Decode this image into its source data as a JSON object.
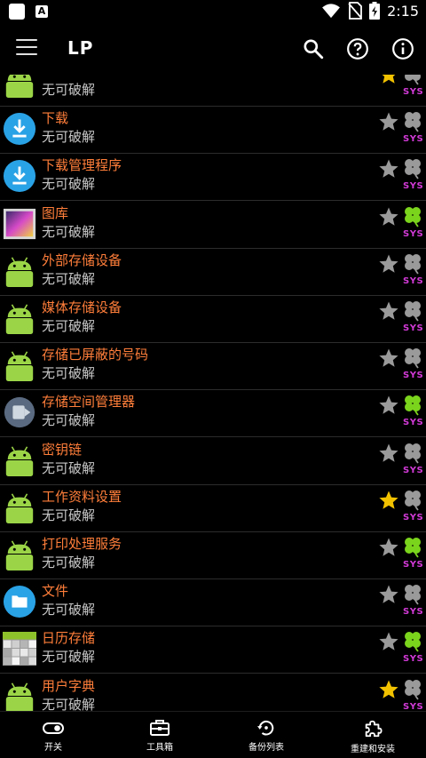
{
  "status_bar": {
    "time": "2:15",
    "icons": [
      "notification-square-icon",
      "text-a-icon",
      "wifi-icon",
      "no-sim-icon",
      "battery-charging-icon"
    ]
  },
  "app_bar": {
    "title": "LP",
    "icons": [
      "menu-icon",
      "search-icon",
      "help-icon",
      "info-icon"
    ]
  },
  "apps": [
    {
      "name": "",
      "status": "无可破解",
      "icon": "android-icon",
      "star": "gold",
      "clover": "gray",
      "badge": "SYS"
    },
    {
      "name": "下载",
      "status": "无可破解",
      "icon": "download-icon",
      "star": "gray",
      "clover": "gray",
      "badge": "SYS"
    },
    {
      "name": "下载管理程序",
      "status": "无可破解",
      "icon": "download-icon",
      "star": "gray",
      "clover": "gray",
      "badge": "SYS"
    },
    {
      "name": "图库",
      "status": "无可破解",
      "icon": "gallery-icon",
      "star": "gray",
      "clover": "green",
      "badge": "SYS"
    },
    {
      "name": "外部存储设备",
      "status": "无可破解",
      "icon": "android-icon",
      "star": "gray",
      "clover": "gray",
      "badge": "SYS"
    },
    {
      "name": "媒体存储设备",
      "status": "无可破解",
      "icon": "android-icon",
      "star": "gray",
      "clover": "gray",
      "badge": "SYS"
    },
    {
      "name": "存储已屏蔽的号码",
      "status": "无可破解",
      "icon": "android-icon",
      "star": "gray",
      "clover": "gray",
      "badge": "SYS"
    },
    {
      "name": "存储空间管理器",
      "status": "无可破解",
      "icon": "storage-manager-icon",
      "star": "gray",
      "clover": "green",
      "badge": "SYS"
    },
    {
      "name": "密钥链",
      "status": "无可破解",
      "icon": "android-icon",
      "star": "gray",
      "clover": "gray",
      "badge": "SYS"
    },
    {
      "name": "工作资料设置",
      "status": "无可破解",
      "icon": "android-icon",
      "star": "gold",
      "clover": "gray",
      "badge": "SYS"
    },
    {
      "name": "打印处理服务",
      "status": "无可破解",
      "icon": "android-icon",
      "star": "gray",
      "clover": "green",
      "badge": "SYS"
    },
    {
      "name": "文件",
      "status": "无可破解",
      "icon": "folder-icon",
      "star": "gray",
      "clover": "gray",
      "badge": "SYS"
    },
    {
      "name": "日历存储",
      "status": "无可破解",
      "icon": "calendar-storage-icon",
      "star": "gray",
      "clover": "green",
      "badge": "SYS"
    },
    {
      "name": "用户字典",
      "status": "无可破解",
      "icon": "android-icon",
      "star": "gold",
      "clover": "gray",
      "badge": "SYS"
    }
  ],
  "bottom_nav": [
    {
      "label": "开关",
      "icon": "toggle-icon"
    },
    {
      "label": "工具箱",
      "icon": "toolbox-icon"
    },
    {
      "label": "备份列表",
      "icon": "backup-restore-icon"
    },
    {
      "label": "重建和安装",
      "icon": "puzzle-icon"
    }
  ],
  "colors": {
    "background": "#000000",
    "app_name": "#ff7e3a",
    "status_text": "#c8c8c8",
    "sys_badge": "#d13ad6",
    "star_gold": "#f2c200",
    "star_gray": "#9a9a9a",
    "clover_green": "#7bd41c",
    "android_green": "#9bd547",
    "download_blue": "#2aa2e6"
  }
}
